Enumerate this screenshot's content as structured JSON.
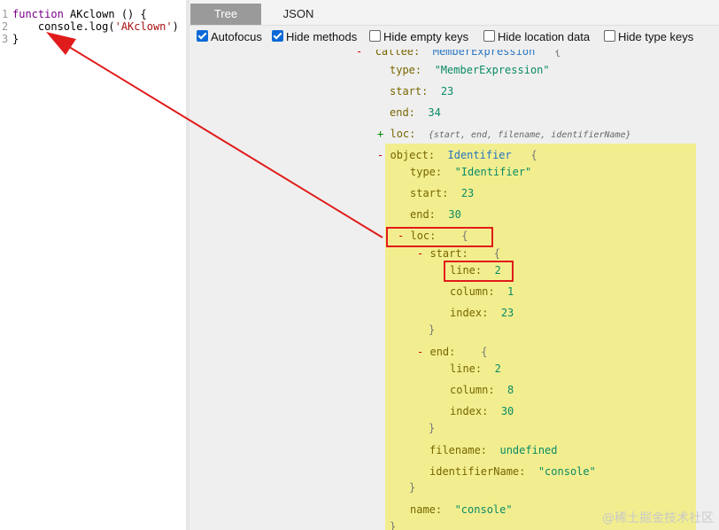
{
  "editor": {
    "lines": [
      {
        "num": "1",
        "keyword": "function",
        "rest": " AKclown () {"
      },
      {
        "num": "2",
        "code": "    console.log(",
        "string": "'AKclown'",
        "tail": ")"
      },
      {
        "num": "3",
        "code": "}"
      }
    ]
  },
  "tabs": [
    {
      "label": "Tree",
      "active": true
    },
    {
      "label": "JSON",
      "active": false
    }
  ],
  "options": [
    {
      "label": "Autofocus",
      "checked": true
    },
    {
      "label": "Hide methods",
      "checked": true
    },
    {
      "label": "Hide empty keys",
      "checked": false
    },
    {
      "label": "Hide location data",
      "checked": false
    },
    {
      "label": "Hide type keys",
      "checked": false
    }
  ],
  "tree": {
    "callee": {
      "toggle": "-",
      "key": "callee:",
      "type": "MemberExpression",
      "brace": "{"
    },
    "callee_type": {
      "key": "type:",
      "value": "\"MemberExpression\""
    },
    "callee_start": {
      "key": "start:",
      "value": "23"
    },
    "callee_end": {
      "key": "end:",
      "value": "34"
    },
    "callee_loc": {
      "toggle": "+",
      "key": "loc:",
      "summary": "{start, end, filename, identifierName}"
    },
    "object": {
      "toggle": "-",
      "key": "object:",
      "type": "Identifier",
      "brace": "{"
    },
    "object_type": {
      "key": "type:",
      "value": "\"Identifier\""
    },
    "object_start": {
      "key": "start:",
      "value": "23"
    },
    "object_end": {
      "key": "end:",
      "value": "30"
    },
    "loc": {
      "toggle": "-",
      "key": "loc:",
      "brace": "{"
    },
    "loc_start": {
      "toggle": "-",
      "key": "start:",
      "brace": "{"
    },
    "start_line": {
      "key": "line:",
      "value": "2"
    },
    "start_column": {
      "key": "column:",
      "value": "1"
    },
    "start_index": {
      "key": "index:",
      "value": "23"
    },
    "start_close": "}",
    "loc_end": {
      "toggle": "-",
      "key": "end:",
      "brace": "{"
    },
    "end_line": {
      "key": "line:",
      "value": "2"
    },
    "end_column": {
      "key": "column:",
      "value": "8"
    },
    "end_index": {
      "key": "index:",
      "value": "30"
    },
    "end_close": "}",
    "filename": {
      "key": "filename:",
      "value": "undefined"
    },
    "identifierName": {
      "key": "identifierName:",
      "value": "\"console\""
    },
    "loc_close": "}",
    "name": {
      "key": "name:",
      "value": "\"console\""
    },
    "object_close": "}"
  },
  "watermark": "@稀土掘金技术社区",
  "colors": {
    "highlight": "#f2ee8f",
    "annotation": "#e01b1b",
    "tab_active": "#9a9a9a"
  }
}
